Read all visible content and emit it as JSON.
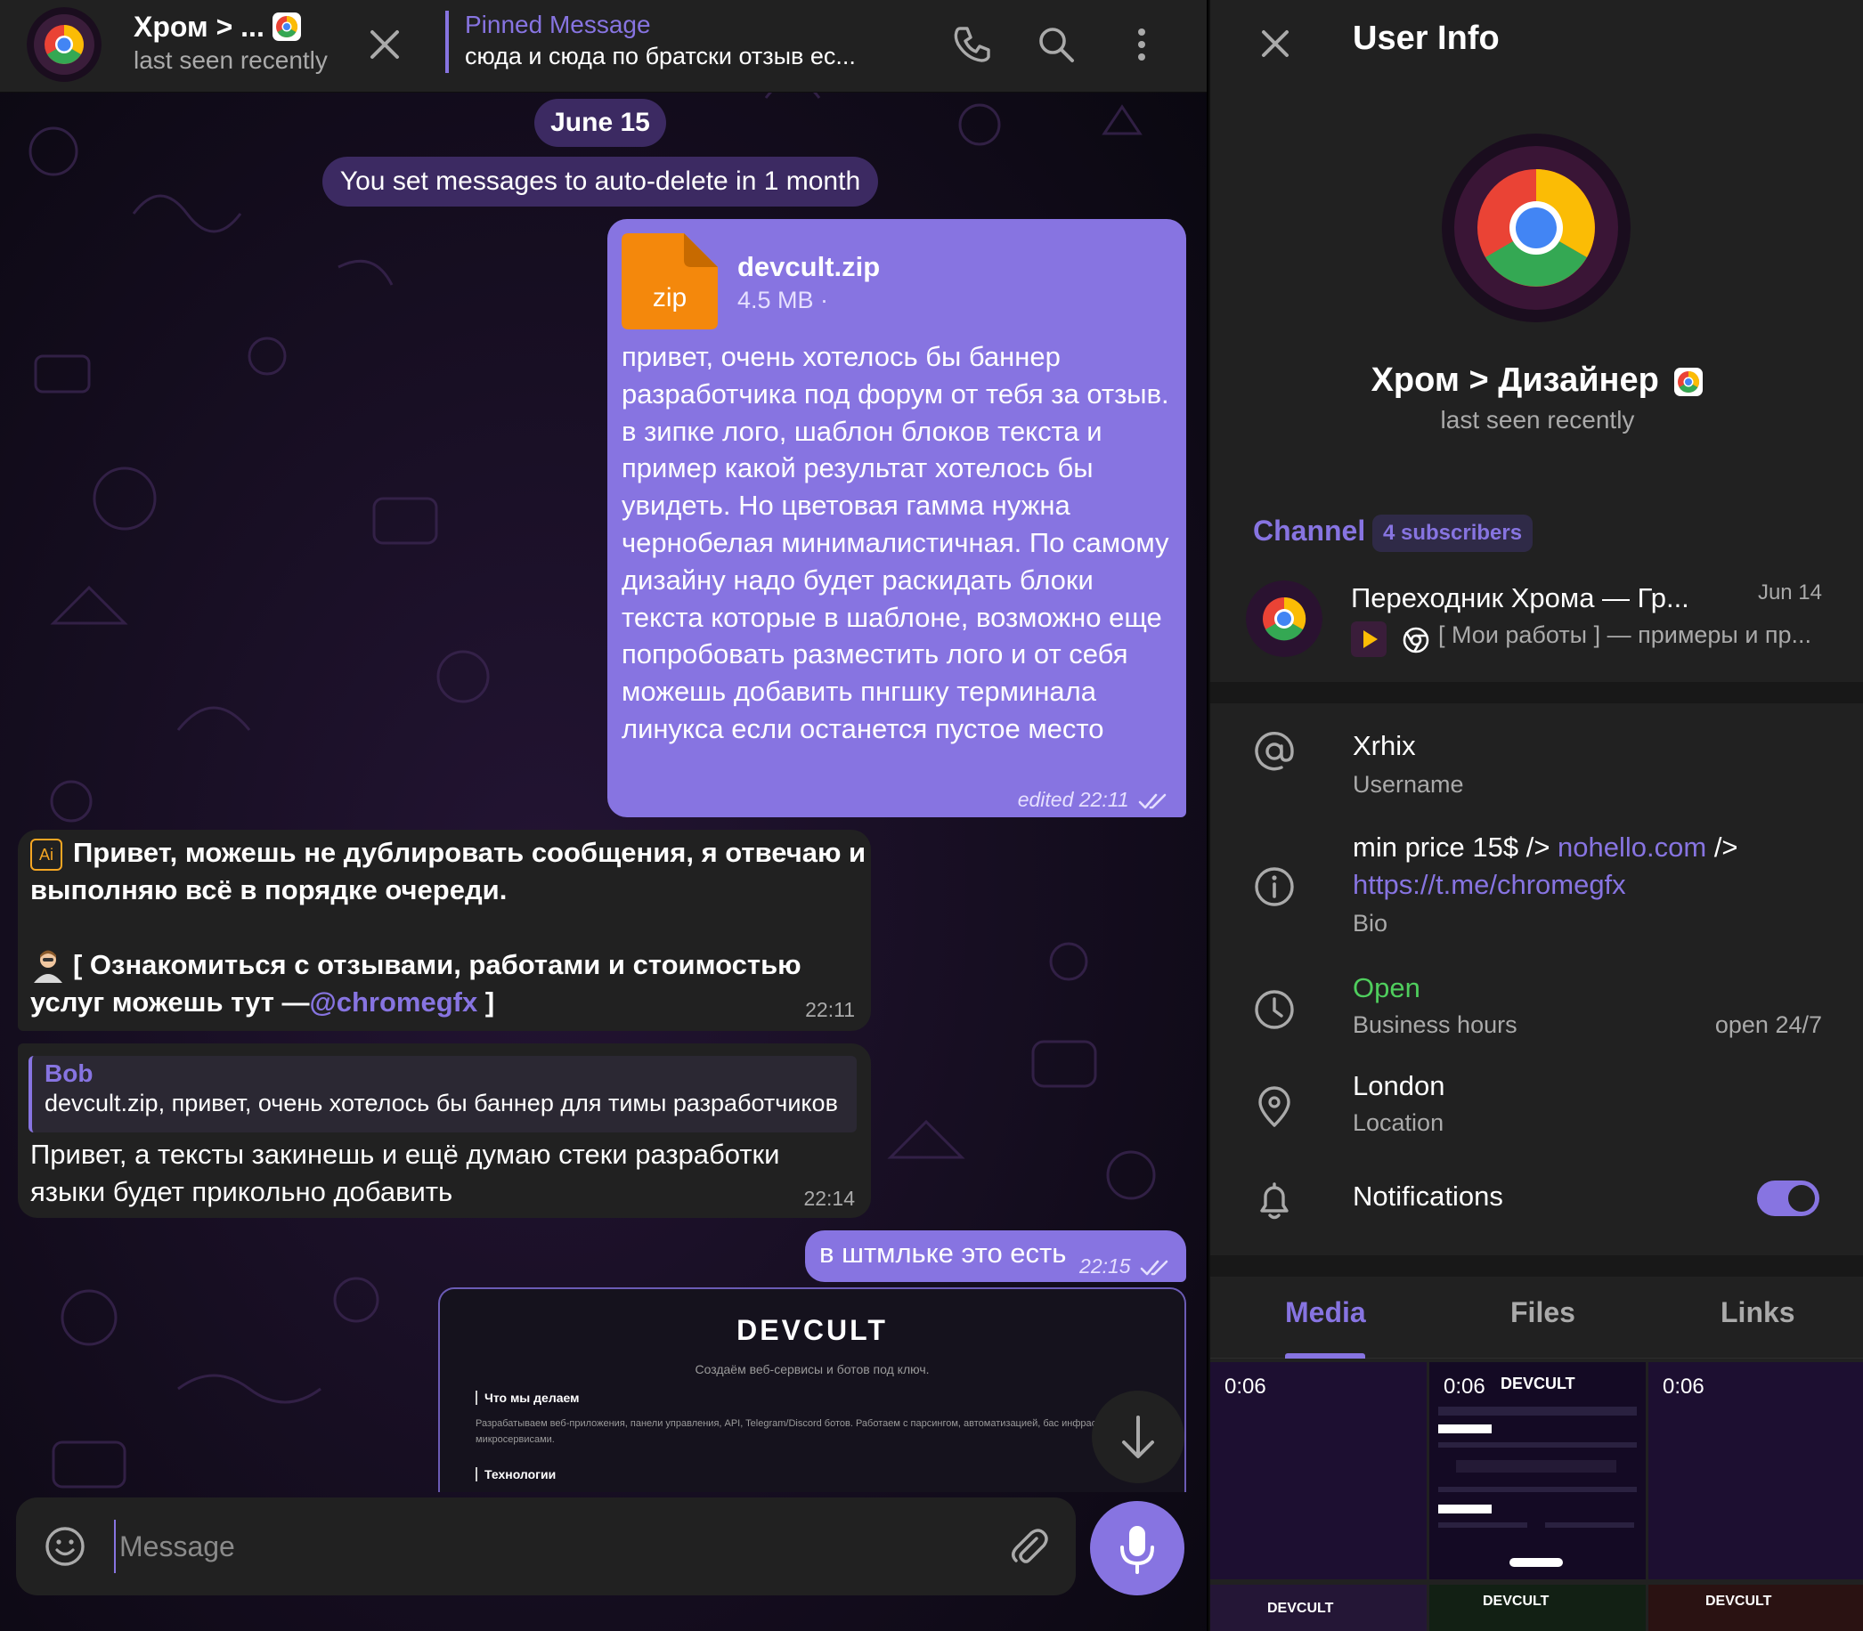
{
  "chat": {
    "header": {
      "title": "Хром > ...",
      "status": "last seen recently",
      "pinned_title": "Pinned Message",
      "pinned_text": "сюда и сюда по братски отзыв ес..."
    },
    "date_label": "June 15",
    "service_message": "You set messages to auto-delete in 1 month",
    "messages": [
      {
        "file_name": "devcult.zip",
        "file_ext": "zip",
        "file_size": "4.5 MB ·",
        "text": "привет, очень хотелось бы баннер разработчика под форум от тебя за отзыв. в зипке лого, шаблон блоков текста и пример какой результат хотелось бы увидеть. Но цветовая гамма нужна чернобелая минималистичная. По самому дизайну надо будет раскидать блоки текста которые в шаблоне, возможно еще попробовать разместить лого и от себя можешь добавить пнгшку терминала линукса если останется пустое место",
        "meta": "edited 22:11"
      },
      {
        "badge": "Ai",
        "line1": "Привет, можешь не дублировать сообщения, я отвечаю и",
        "line2": "выполняю всё в порядке очереди.",
        "line3": "[ Ознакомиться с отзывами, работами и стоимостью",
        "line4_prefix": "услуг можешь тут —",
        "line4_link": "@chromegfx",
        "line4_suffix": " ]",
        "time": "22:11"
      },
      {
        "reply_name": "Bob",
        "reply_text": "devcult.zip, привет, очень хотелось бы баннер для тимы разработчиков",
        "text": "Привет, а тексты закинешь и ещё думаю стеки разработки языки будет прикольно добавить",
        "time": "22:14"
      },
      {
        "text": "в штмльке это есть",
        "time": "22:15"
      }
    ],
    "preview": {
      "title": "DEVCULT",
      "subtitle": "Создаём веб-сервисы и ботов под ключ.",
      "section1": "Что мы делаем",
      "section1_text": "Разрабатываем веб-приложения, панели управления, API, Telegram/Discord ботов. Работаем с парсингом, автоматизацией, бас инфраструктурой, микросервисами.",
      "section2": "Технологии"
    },
    "composer": {
      "placeholder": "Message"
    }
  },
  "info": {
    "title": "User Info",
    "name": "Хром > Дизайнер",
    "status": "last seen recently",
    "channel_label": "Channel",
    "channel_badge": "4 subscribers",
    "channel_name": "Переходник Хрома — Гр...",
    "channel_date": "Jun 14",
    "channel_preview": "[ Мои работы ] — примеры и пр...",
    "username": "Xrhix",
    "username_label": "Username",
    "bio_prefix": "min price 15$ /> ",
    "bio_link1": "nohello.com",
    "bio_mid": " />",
    "bio_link2": "https://t.me/chromegfx",
    "bio_label": "Bio",
    "hours_status": "Open",
    "hours_label": "Business hours",
    "hours_value": "open 24/7",
    "location": "London",
    "location_label": "Location",
    "notifications_label": "Notifications",
    "notifications_on": true,
    "tabs": [
      "Media",
      "Files",
      "Links"
    ],
    "media": [
      {
        "duration": "0:06",
        "brand": ""
      },
      {
        "duration": "0:06",
        "brand": "DEVCULT"
      },
      {
        "duration": "0:06",
        "brand": ""
      },
      {
        "duration": "",
        "brand": "DEVCULT"
      },
      {
        "duration": "",
        "brand": "DEVCULT"
      },
      {
        "duration": "",
        "brand": "DEVCULT"
      }
    ]
  },
  "colors": {
    "accent": "#8774e1",
    "bubble_out": "#8774e1",
    "bubble_in": "#212121",
    "panel": "#212121",
    "green": "#4fce5d"
  }
}
